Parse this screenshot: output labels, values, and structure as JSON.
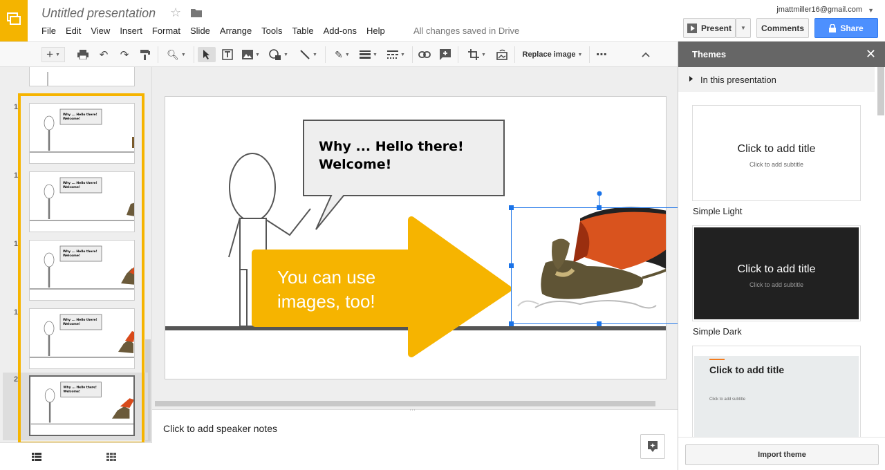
{
  "app": {
    "title": "Untitled presentation",
    "account": "jmattmiller16@gmail.com",
    "saved_status": "All changes saved in Drive"
  },
  "menu": [
    "File",
    "Edit",
    "View",
    "Insert",
    "Format",
    "Slide",
    "Arrange",
    "Tools",
    "Table",
    "Add-ons",
    "Help"
  ],
  "buttons": {
    "present": "Present",
    "comments": "Comments",
    "share": "Share"
  },
  "toolbar": {
    "replace_image": "Replace image"
  },
  "filmstrip": {
    "numbers": [
      "1",
      "1",
      "1",
      "1",
      "2"
    ]
  },
  "slide": {
    "bubble_text": "Why ... Hello there! Welcome!",
    "arrow_text": "You can use images, too!"
  },
  "notes": {
    "placeholder": "Click to add speaker notes"
  },
  "themes": {
    "header": "Themes",
    "section": "In this presentation",
    "cards": [
      {
        "name": "Simple Light",
        "title": "Click to add title",
        "subtitle": "Click to add subtitle"
      },
      {
        "name": "Simple Dark",
        "title": "Click to add title",
        "subtitle": "Click to add subtitle"
      },
      {
        "name": "",
        "title": "Click to add title",
        "subtitle": "Click to add subtitle"
      }
    ],
    "import_label": "Import theme"
  },
  "colors": {
    "brand_yellow": "#f4b400",
    "share_blue": "#4d90fe",
    "arrow_yellow": "#f6b400",
    "selection_blue": "#1a73e8"
  }
}
